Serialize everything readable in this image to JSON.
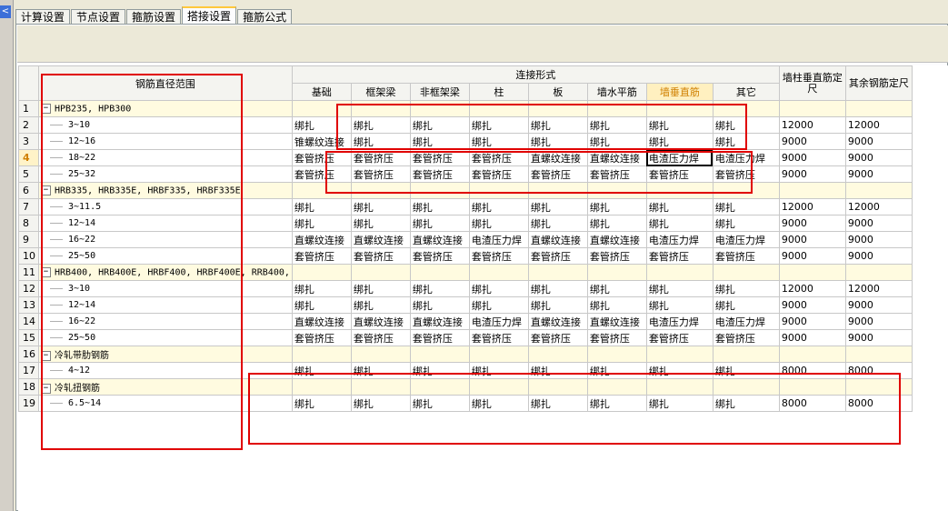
{
  "tabs": [
    {
      "label": "计算设置"
    },
    {
      "label": "节点设置"
    },
    {
      "label": "箍筋设置"
    },
    {
      "label": "搭接设置"
    },
    {
      "label": "箍筋公式"
    }
  ],
  "nav": {
    "left_arrow": "<"
  },
  "table": {
    "headers": {
      "range": "钢筋直径范围",
      "connection_group": "连接形式",
      "columns": [
        "基础",
        "框架梁",
        "非框架梁",
        "柱",
        "板",
        "墙水平筋",
        "墙垂直筋",
        "其它"
      ],
      "wall_vertical_length": "墙柱垂直筋定尺",
      "other_length": "其余钢筋定尺"
    },
    "rows": [
      {
        "no": "1",
        "group": true,
        "label": "HPB235, HPB300"
      },
      {
        "no": "2",
        "label": "3~10",
        "cells": [
          "绑扎",
          "绑扎",
          "绑扎",
          "绑扎",
          "绑扎",
          "绑扎",
          "绑扎",
          "绑扎"
        ],
        "len1": "12000",
        "len2": "12000"
      },
      {
        "no": "3",
        "label": "12~16",
        "cells": [
          "锥螺纹连接",
          "绑扎",
          "绑扎",
          "绑扎",
          "绑扎",
          "绑扎",
          "绑扎",
          "绑扎"
        ],
        "len1": "9000",
        "len2": "9000"
      },
      {
        "no": "4",
        "label": "18~22",
        "cells": [
          "套管挤压",
          "套管挤压",
          "套管挤压",
          "套管挤压",
          "直螺纹连接",
          "直螺纹连接",
          "电渣压力焊",
          "电渣压力焊"
        ],
        "len1": "9000",
        "len2": "9000",
        "current": true
      },
      {
        "no": "5",
        "label": "25~32",
        "cells": [
          "套管挤压",
          "套管挤压",
          "套管挤压",
          "套管挤压",
          "套管挤压",
          "套管挤压",
          "套管挤压",
          "套管挤压"
        ],
        "len1": "9000",
        "len2": "9000"
      },
      {
        "no": "6",
        "group": true,
        "label": "HRB335, HRB335E, HRBF335, HRBF335E"
      },
      {
        "no": "7",
        "label": "3~11.5",
        "cells": [
          "绑扎",
          "绑扎",
          "绑扎",
          "绑扎",
          "绑扎",
          "绑扎",
          "绑扎",
          "绑扎"
        ],
        "len1": "12000",
        "len2": "12000"
      },
      {
        "no": "8",
        "label": "12~14",
        "cells": [
          "绑扎",
          "绑扎",
          "绑扎",
          "绑扎",
          "绑扎",
          "绑扎",
          "绑扎",
          "绑扎"
        ],
        "len1": "9000",
        "len2": "9000"
      },
      {
        "no": "9",
        "label": "16~22",
        "cells": [
          "直螺纹连接",
          "直螺纹连接",
          "直螺纹连接",
          "电渣压力焊",
          "直螺纹连接",
          "直螺纹连接",
          "电渣压力焊",
          "电渣压力焊"
        ],
        "len1": "9000",
        "len2": "9000"
      },
      {
        "no": "10",
        "label": "25~50",
        "cells": [
          "套管挤压",
          "套管挤压",
          "套管挤压",
          "套管挤压",
          "套管挤压",
          "套管挤压",
          "套管挤压",
          "套管挤压"
        ],
        "len1": "9000",
        "len2": "9000"
      },
      {
        "no": "11",
        "group": true,
        "label": "HRB400, HRB400E, HRBF400, HRBF400E, RRB400,"
      },
      {
        "no": "12",
        "label": "3~10",
        "cells": [
          "绑扎",
          "绑扎",
          "绑扎",
          "绑扎",
          "绑扎",
          "绑扎",
          "绑扎",
          "绑扎"
        ],
        "len1": "12000",
        "len2": "12000"
      },
      {
        "no": "13",
        "label": "12~14",
        "cells": [
          "绑扎",
          "绑扎",
          "绑扎",
          "绑扎",
          "绑扎",
          "绑扎",
          "绑扎",
          "绑扎"
        ],
        "len1": "9000",
        "len2": "9000"
      },
      {
        "no": "14",
        "label": "16~22",
        "cells": [
          "直螺纹连接",
          "直螺纹连接",
          "直螺纹连接",
          "电渣压力焊",
          "直螺纹连接",
          "直螺纹连接",
          "电渣压力焊",
          "电渣压力焊"
        ],
        "len1": "9000",
        "len2": "9000"
      },
      {
        "no": "15",
        "label": "25~50",
        "cells": [
          "套管挤压",
          "套管挤压",
          "套管挤压",
          "套管挤压",
          "套管挤压",
          "套管挤压",
          "套管挤压",
          "套管挤压"
        ],
        "len1": "9000",
        "len2": "9000"
      },
      {
        "no": "16",
        "group": true,
        "label": "冷轧带肋钢筋"
      },
      {
        "no": "17",
        "label": "4~12",
        "cells": [
          "绑扎",
          "绑扎",
          "绑扎",
          "绑扎",
          "绑扎",
          "绑扎",
          "绑扎",
          "绑扎"
        ],
        "len1": "8000",
        "len2": "8000"
      },
      {
        "no": "18",
        "group": true,
        "label": "冷轧扭钢筋"
      },
      {
        "no": "19",
        "label": "6.5~14",
        "cells": [
          "绑扎",
          "绑扎",
          "绑扎",
          "绑扎",
          "绑扎",
          "绑扎",
          "绑扎",
          "绑扎"
        ],
        "len1": "8000",
        "len2": "8000"
      }
    ]
  },
  "colors": {
    "annotation": "#e00000",
    "highlight_header": "#d08000"
  }
}
